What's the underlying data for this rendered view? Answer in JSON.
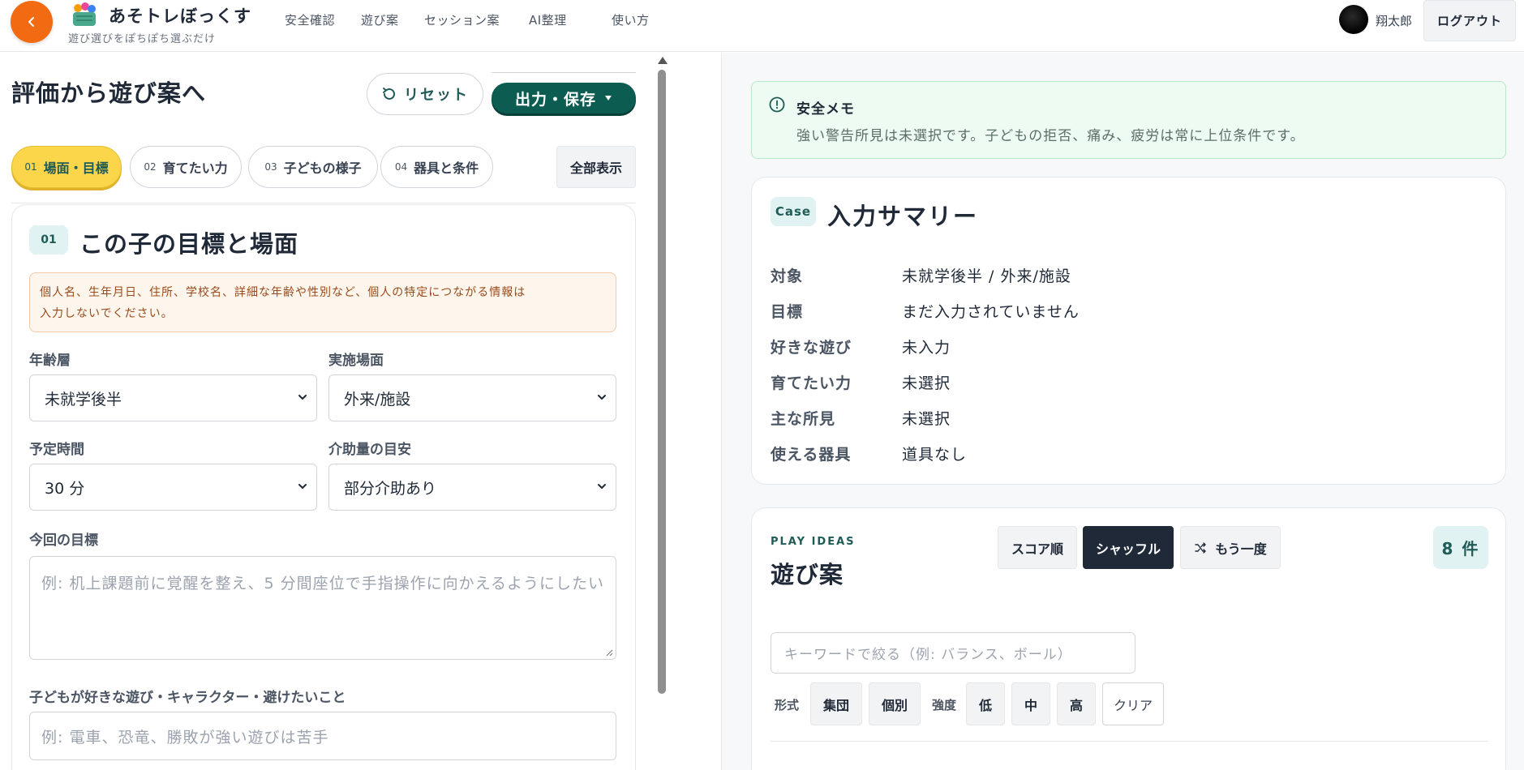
{
  "header": {
    "back_icon": "chevron-left-icon",
    "logo_icon": "toy-basket-icon",
    "app_title": "あそトレぼっくす",
    "app_subtitle": "遊び選びをぽちぽち選ぶだけ",
    "nav": [
      "安全確認",
      "遊び案",
      "セッション案",
      "AI整理",
      "使い方"
    ],
    "user_name": "翔太郎",
    "logout_label": "ログアウト"
  },
  "left": {
    "page_title": "評価から遊び案へ",
    "reset_label": "リセット",
    "export_label": "出力・保存",
    "steps": [
      {
        "num": "01",
        "label": "場面・目標"
      },
      {
        "num": "02",
        "label": "育てたい力"
      },
      {
        "num": "03",
        "label": "子どもの様子"
      },
      {
        "num": "04",
        "label": "器具と条件"
      }
    ],
    "show_all_label": "全部表示",
    "section": {
      "badge": "01",
      "title": "この子の目標と場面",
      "warning_line1": "個人名、生年月日、住所、学校名、詳細な年齢や性別など、個人の特定につながる情報は",
      "warning_line2": "入力しないでください。",
      "age_label": "年齢層",
      "age_value": "未就学後半",
      "place_label": "実施場面",
      "place_value": "外来/施設",
      "time_label": "予定時間",
      "time_value": "30 分",
      "assist_label": "介助量の目安",
      "assist_value": "部分介助あり",
      "goal_label": "今回の目標",
      "goal_placeholder": "例: 机上課題前に覚醒を整え、5 分間座位で手指操作に向かえるようにしたい",
      "likes_label": "子どもが好きな遊び・キャラクター・避けたいこと",
      "likes_placeholder": "例: 電車、恐竜、勝敗が強い遊びは苦手"
    }
  },
  "right": {
    "safety": {
      "title": "安全メモ",
      "text": "強い警告所見は未選択です。子どもの拒否、痛み、疲労は常に上位条件です。"
    },
    "summary": {
      "badge": "Case",
      "title": "入力サマリー",
      "rows": [
        {
          "key": "対象",
          "value": "未就学後半 / 外来/施設"
        },
        {
          "key": "目標",
          "value": "まだ入力されていません"
        },
        {
          "key": "好きな遊び",
          "value": "未入力"
        },
        {
          "key": "育てたい力",
          "value": "未選択"
        },
        {
          "key": "主な所見",
          "value": "未選択"
        },
        {
          "key": "使える器具",
          "value": "道具なし"
        }
      ]
    },
    "ideas": {
      "eyebrow": "PLAY IDEAS",
      "title": "遊び案",
      "sort_score": "スコア順",
      "sort_shuffle": "シャッフル",
      "again": "もう一度",
      "count": "8 件",
      "keyword_placeholder": "キーワードで絞る（例: バランス、ボール）",
      "format_label": "形式",
      "format_group": "集団",
      "format_individual": "個別",
      "intensity_label": "強度",
      "intensity_low": "低",
      "intensity_mid": "中",
      "intensity_high": "高",
      "clear_label": "クリア"
    }
  },
  "colors": {
    "accent_orange": "#f26a11",
    "brand_teal": "#0d5c52",
    "active_step": "#fbd54a",
    "safety_bg": "#eefbf2",
    "warning_bg": "#fef5ec"
  }
}
